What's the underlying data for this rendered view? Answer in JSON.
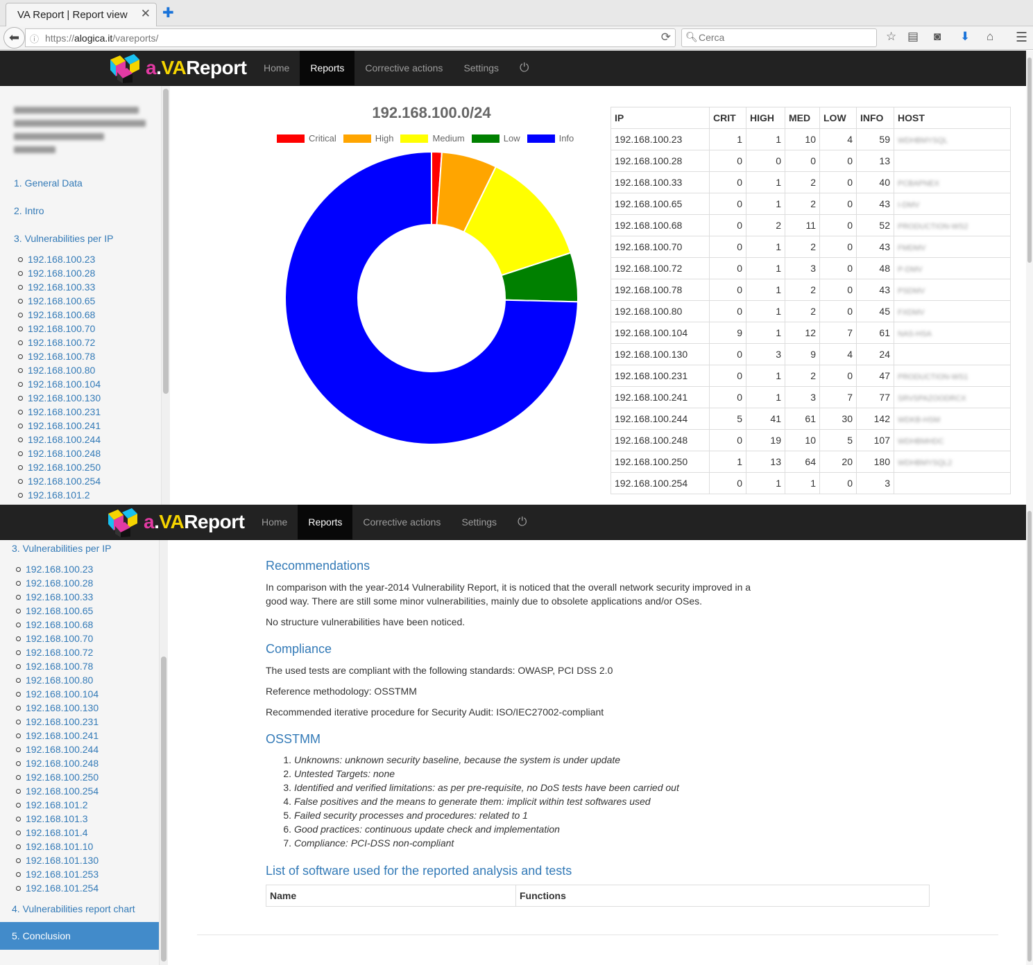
{
  "browser": {
    "tab_title": "VA Report | Report view",
    "url_prefix": "https://",
    "url_host": "alogica.it",
    "url_path": "/vareports/",
    "search_placeholder": "Cerca"
  },
  "app": {
    "logo_a": "a",
    "logo_dot": ".",
    "logo_va": "VA",
    "logo_report": "Report",
    "nav": [
      {
        "label": "Home"
      },
      {
        "label": "Reports"
      },
      {
        "label": "Corrective actions"
      },
      {
        "label": "Settings"
      }
    ],
    "active_nav": "Reports"
  },
  "sidebar_top": {
    "sections": [
      "1. General Data",
      "2. Intro",
      "3. Vulnerabilities per IP"
    ],
    "ips": [
      "192.168.100.23",
      "192.168.100.28",
      "192.168.100.33",
      "192.168.100.65",
      "192.168.100.68",
      "192.168.100.70",
      "192.168.100.72",
      "192.168.100.78",
      "192.168.100.80",
      "192.168.100.104",
      "192.168.100.130",
      "192.168.100.231",
      "192.168.100.241",
      "192.168.100.244",
      "192.168.100.248",
      "192.168.100.250",
      "192.168.100.254",
      "192.168.101.2"
    ]
  },
  "sidebar_bottom": {
    "section3": "3. Vulnerabilities per IP",
    "ips": [
      "192.168.100.23",
      "192.168.100.28",
      "192.168.100.33",
      "192.168.100.65",
      "192.168.100.68",
      "192.168.100.70",
      "192.168.100.72",
      "192.168.100.78",
      "192.168.100.80",
      "192.168.100.104",
      "192.168.100.130",
      "192.168.100.231",
      "192.168.100.241",
      "192.168.100.244",
      "192.168.100.248",
      "192.168.100.250",
      "192.168.100.254",
      "192.168.101.2",
      "192.168.101.3",
      "192.168.101.4",
      "192.168.101.10",
      "192.168.101.130",
      "192.168.101.253",
      "192.168.101.254"
    ],
    "section4": "4. Vulnerabilities report chart",
    "section5": "5. Conclusion"
  },
  "chart_data": {
    "type": "pie",
    "variant": "donut",
    "title": "192.168.100.0/24",
    "legend_position": "top",
    "categories": [
      "Critical",
      "High",
      "Medium",
      "Low",
      "Info"
    ],
    "values": [
      16,
      87,
      181,
      77,
      1060
    ],
    "colors": [
      "#ff0000",
      "#ffa500",
      "#ffff00",
      "#008000",
      "#0000ff"
    ]
  },
  "ip_table": {
    "headers": [
      "IP",
      "CRIT",
      "HIGH",
      "MED",
      "LOW",
      "INFO",
      "HOST"
    ],
    "rows": [
      [
        "192.168.100.23",
        "1",
        "1",
        "10",
        "4",
        "59",
        "WDHBMYSQL"
      ],
      [
        "192.168.100.28",
        "0",
        "0",
        "0",
        "0",
        "13",
        ""
      ],
      [
        "192.168.100.33",
        "0",
        "1",
        "2",
        "0",
        "40",
        "PCBAPNEX"
      ],
      [
        "192.168.100.65",
        "0",
        "1",
        "2",
        "0",
        "43",
        "I-DMV"
      ],
      [
        "192.168.100.68",
        "0",
        "2",
        "11",
        "0",
        "52",
        "PRODUCTION-WS2"
      ],
      [
        "192.168.100.70",
        "0",
        "1",
        "2",
        "0",
        "43",
        "FMDMV"
      ],
      [
        "192.168.100.72",
        "0",
        "1",
        "3",
        "0",
        "48",
        "P-DMV"
      ],
      [
        "192.168.100.78",
        "0",
        "1",
        "2",
        "0",
        "43",
        "PSDMV"
      ],
      [
        "192.168.100.80",
        "0",
        "1",
        "2",
        "0",
        "45",
        "FXDMV"
      ],
      [
        "192.168.100.104",
        "9",
        "1",
        "12",
        "7",
        "61",
        "NAS-HSA"
      ],
      [
        "192.168.100.130",
        "0",
        "3",
        "9",
        "4",
        "24",
        ""
      ],
      [
        "192.168.100.231",
        "0",
        "1",
        "2",
        "0",
        "47",
        "PRODUCTION-WS1"
      ],
      [
        "192.168.100.241",
        "0",
        "1",
        "3",
        "7",
        "77",
        "SRVSPAZOODRCX"
      ],
      [
        "192.168.100.244",
        "5",
        "41",
        "61",
        "30",
        "142",
        "WDKB-HSM"
      ],
      [
        "192.168.100.248",
        "0",
        "19",
        "10",
        "5",
        "107",
        "WDHBMHDC"
      ],
      [
        "192.168.100.250",
        "1",
        "13",
        "64",
        "20",
        "180",
        "WDHBMYSQL2"
      ],
      [
        "192.168.100.254",
        "0",
        "1",
        "1",
        "0",
        "3",
        ""
      ]
    ]
  },
  "content": {
    "recommendations_title": "Recommendations",
    "recommendations_p1": "In comparison with the year-2014 Vulnerability Report, it is noticed that the overall network security improved in a good way. There are still some minor vulnerabilities, mainly due to obsolete applications and/or OSes.",
    "recommendations_p2": "No structure vulnerabilities have been noticed.",
    "compliance_title": "Compliance",
    "compliance_p1": "The used tests are compliant with the following standards: OWASP, PCI DSS 2.0",
    "compliance_p2": "Reference methodology: OSSTMM",
    "compliance_p3": "Recommended iterative procedure for Security Audit: ISO/IEC27002-compliant",
    "osstmm_title": "OSSTMM",
    "osstmm_items": [
      "Unknowns: unknown security baseline, because the system is under update",
      "Untested Targets: none",
      "Identified and verified limitations: as per pre-requisite, no DoS tests have been carried out",
      "False positives and the means to generate them: implicit within test softwares used",
      "Failed security processes and procedures: related to 1",
      "Good practices: continuous update check and implementation",
      "Compliance: PCI-DSS non-compliant"
    ],
    "software_title": "List of software used for the reported analysis and tests",
    "software_headers": [
      "Name",
      "Functions"
    ]
  },
  "colors": {
    "navbar": "#222222",
    "nav_active": "#080808",
    "link": "#337ab7",
    "sidebar_active": "#428bca"
  },
  "icons": [
    "back-arrow-icon",
    "info-icon",
    "reload-icon",
    "search-icon",
    "star-icon",
    "reading-list-icon",
    "pocket-icon",
    "download-icon",
    "home-icon",
    "menu-icon",
    "power-icon",
    "close-icon",
    "plus-icon"
  ]
}
